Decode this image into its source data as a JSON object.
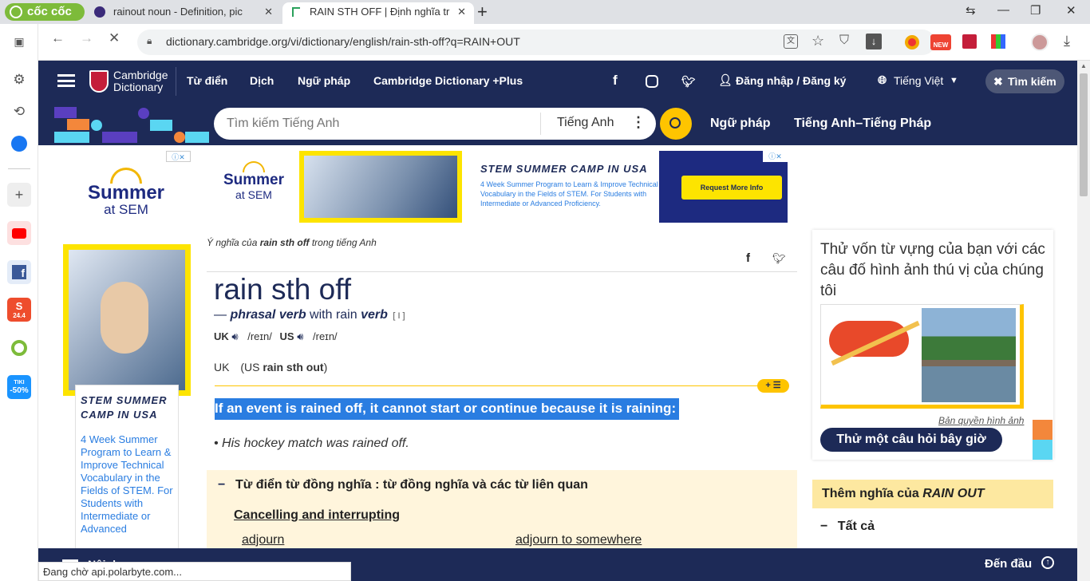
{
  "browser": {
    "brand": "cốc cốc",
    "tabs": [
      {
        "title": "rainout noun - Definition, pic",
        "active": false
      },
      {
        "title": "RAIN STH OFF | Định nghĩa tr",
        "active": true
      }
    ],
    "new_tab": "+",
    "url": "dictionary.cambridge.org/vi/dictionary/english/rain-sth-off?q=RAIN+OUT",
    "status": "Đang chờ api.polarbyte.com..."
  },
  "sidebar": {
    "shopee_badge": "24.4",
    "tiki_label": "TIKI",
    "tiki_discount": "-50%"
  },
  "header": {
    "logo_line1": "Cambridge",
    "logo_line2": "Dictionary",
    "nav": [
      "Từ điển",
      "Dịch",
      "Ngữ pháp",
      "Cambridge Dictionary +Plus"
    ],
    "login": "Đăng nhập / Đăng ký",
    "language": "Tiếng Việt",
    "search_button": "Tìm kiếm"
  },
  "subheader": {
    "search_placeholder": "Tìm kiếm Tiếng Anh",
    "search_lang": "Tiếng Anh",
    "links": [
      "Ngữ pháp",
      "Tiếng Anh–Tiếng Pháp"
    ]
  },
  "ads": {
    "left_brand_1": "Summer",
    "left_brand_2": "at SEM",
    "banner_title": "STEM SUMMER CAMP IN USA",
    "banner_text": "4 Week Summer Program to Learn & Improve Technical Vocabulary in the Fields of STEM. For Students with Intermediate or Advanced Proficiency.",
    "banner_button": "Request More Info",
    "left_title": "STEM SUMMER CAMP IN USA",
    "left_text": "4 Week Summer Program to Learn & Improve Technical Vocabulary in the Fields of STEM. For Students with Intermediate or Advanced"
  },
  "entry": {
    "breadcrumb_pre": "Ý nghĩa của ",
    "breadcrumb_word": "rain sth off",
    "breadcrumb_post": " trong tiếng Anh",
    "headword": "rain sth off",
    "pos_dash": "— ",
    "pos": "phrasal verb",
    "pos_with": " with rain ",
    "pos_verb": "verb",
    "pos_code": "[ I ]",
    "uk": "UK",
    "us": "US",
    "ipa_uk": "/reɪn/",
    "ipa_us": "/reɪn/",
    "variant_uk": "UK",
    "variant_us": "(US ",
    "variant_word": "rain sth out",
    "variant_close": ")",
    "definition": "If an event is rained off, it cannot start or continue because it is raining:",
    "example": "His hockey match was rained off.",
    "thesaurus_heading": "Từ điển từ đồng nghĩa : từ đồng nghĩa và các từ liên quan",
    "thesaurus_group": "Cancelling and interrupting",
    "thesaurus_words": [
      "adjourn",
      "adjourn to somewhere"
    ]
  },
  "right": {
    "quiz_text": "Thử vốn từ vựng của bạn với các câu đố hình ảnh thú vị của chúng tôi",
    "copyright": "Bản quyền hình ảnh",
    "quiz_button": "Thử một câu hỏi bây giờ",
    "more_pre": "Thêm nghĩa của ",
    "more_word": "RAIN OUT",
    "all_label": "Tất cả"
  },
  "footer": {
    "left_text": "Nội dung",
    "top_link": "Đến đầu"
  },
  "colors": {
    "navy": "#1d2a57",
    "yellow": "#fec400",
    "highlight": "#2a7de1",
    "thesaurus_bg": "#fff5dc"
  }
}
